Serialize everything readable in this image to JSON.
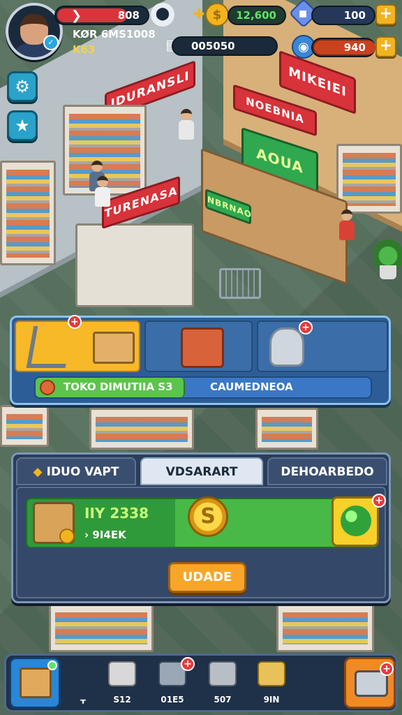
{
  "hud": {
    "player_level": "808",
    "player_line1": "KØR 6MS1008",
    "player_line2": "K63",
    "cash_value": "12,600",
    "gems_value": "100",
    "gems_plus": "+",
    "energy_value": "940",
    "energy_plus": "+",
    "inventory_value": "005050",
    "gear_glyph": "⚙",
    "side_star_glyph": "★"
  },
  "store": {
    "sign_left_wall": "IDURANSLI",
    "sign_right_wall": "MIKEIEI",
    "sign_center_red": "NOEBNIA",
    "sign_green_screen": "AOUA",
    "sign_counter_green": "NBRNAO",
    "sign_kiosk_red": "TURENASA"
  },
  "upgrade_panel": {
    "progress_label": "TOKO DIMUTIIA S3",
    "right_label": "CAUMEDNEOA",
    "plus": "+"
  },
  "shop_panel": {
    "tabs": [
      "IDUO VAPT",
      "VDSARART",
      "DEHOARBEDO"
    ],
    "item_title": "IIY 2338",
    "item_subtitle": "› 9I4EK",
    "upgrade_button": "UDADE",
    "plus": "+"
  },
  "bottom_bar": {
    "items": [
      {
        "value": "ᚁ"
      },
      {
        "value": "S12"
      },
      {
        "value": "01E5"
      },
      {
        "value": "507"
      },
      {
        "value": "9IN"
      }
    ],
    "plus": "+"
  },
  "colors": {
    "accent_orange": "#f7b928",
    "accent_green": "#48b946",
    "panel_blue": "#2c5d96",
    "alert_red": "#e33b3b"
  }
}
